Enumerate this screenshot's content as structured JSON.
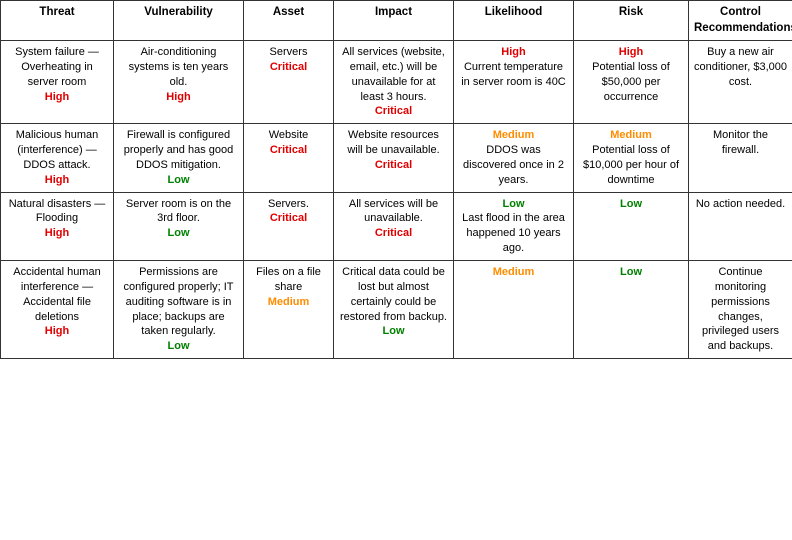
{
  "headers": [
    "Threat",
    "Vulnerability",
    "Asset",
    "Impact",
    "Likelihood",
    "Risk",
    "Control Recommendations"
  ],
  "rows": [
    {
      "threat": {
        "text": "System failure — Overheating in server room",
        "badge": "High",
        "badge_color": "red"
      },
      "vulnerability": {
        "text": "Air-conditioning systems is ten years old.",
        "badge": "High",
        "badge_color": "red"
      },
      "asset": {
        "text": "Servers",
        "badge": "Critical",
        "badge_color": "red"
      },
      "impact": {
        "text": "All services (website, email, etc.) will be unavailable for at least 3 hours.",
        "badge": "Critical",
        "badge_color": "red"
      },
      "likelihood": {
        "text": "Current temperature in server room is 40C",
        "badge": "High",
        "badge_color": "red",
        "badge_pos": "before"
      },
      "risk": {
        "text": "Potential loss of $50,000 per occurrence",
        "badge": "High",
        "badge_color": "red",
        "badge_pos": "before"
      },
      "control": {
        "text": "Buy a new air conditioner, $3,000 cost."
      }
    },
    {
      "threat": {
        "text": "Malicious human (interference) — DDOS attack.",
        "badge": "High",
        "badge_color": "red"
      },
      "vulnerability": {
        "text": "Firewall is configured properly and has good DDOS mitigation.",
        "badge": "Low",
        "badge_color": "green"
      },
      "asset": {
        "text": "Website",
        "badge": "Critical",
        "badge_color": "red"
      },
      "impact": {
        "text": "Website resources will be unavailable.",
        "badge": "Critical",
        "badge_color": "red"
      },
      "likelihood": {
        "text": "DDOS was discovered once in 2 years.",
        "badge": "Medium",
        "badge_color": "orange",
        "badge_pos": "before"
      },
      "risk": {
        "text": "Potential loss of $10,000 per hour of downtime",
        "badge": "Medium",
        "badge_color": "orange",
        "badge_pos": "before"
      },
      "control": {
        "text": "Monitor the firewall."
      }
    },
    {
      "threat": {
        "text": "Natural disasters — Flooding",
        "badge": "High",
        "badge_color": "red"
      },
      "vulnerability": {
        "text": "Server room is on the 3rd floor.",
        "badge": "Low",
        "badge_color": "green"
      },
      "asset": {
        "text": "Servers.",
        "badge": "Critical",
        "badge_color": "red"
      },
      "impact": {
        "text": "All services will be unavailable.",
        "badge": "Critical",
        "badge_color": "red"
      },
      "likelihood": {
        "text": "Last flood in the area happened 10 years ago.",
        "badge": "Low",
        "badge_color": "green",
        "badge_pos": "before"
      },
      "risk": {
        "badge": "Low",
        "badge_color": "green",
        "badge_pos": "only"
      },
      "control": {
        "text": "No action needed."
      }
    },
    {
      "threat": {
        "text": "Accidental human interference — Accidental file deletions",
        "badge": "High",
        "badge_color": "red"
      },
      "vulnerability": {
        "text": "Permissions are configured properly; IT auditing software is in place; backups are taken regularly.",
        "badge": "Low",
        "badge_color": "green"
      },
      "asset": {
        "text": "Files on a file share",
        "badge": "Medium",
        "badge_color": "orange"
      },
      "impact": {
        "text": "Critical data could be lost but almost certainly could be restored from backup.",
        "badge": "Low",
        "badge_color": "green"
      },
      "likelihood": {
        "badge": "Medium",
        "badge_color": "orange",
        "badge_pos": "only"
      },
      "risk": {
        "badge": "Low",
        "badge_color": "green",
        "badge_pos": "only"
      },
      "control": {
        "text": "Continue monitoring permissions changes, privileged users and backups."
      }
    }
  ]
}
